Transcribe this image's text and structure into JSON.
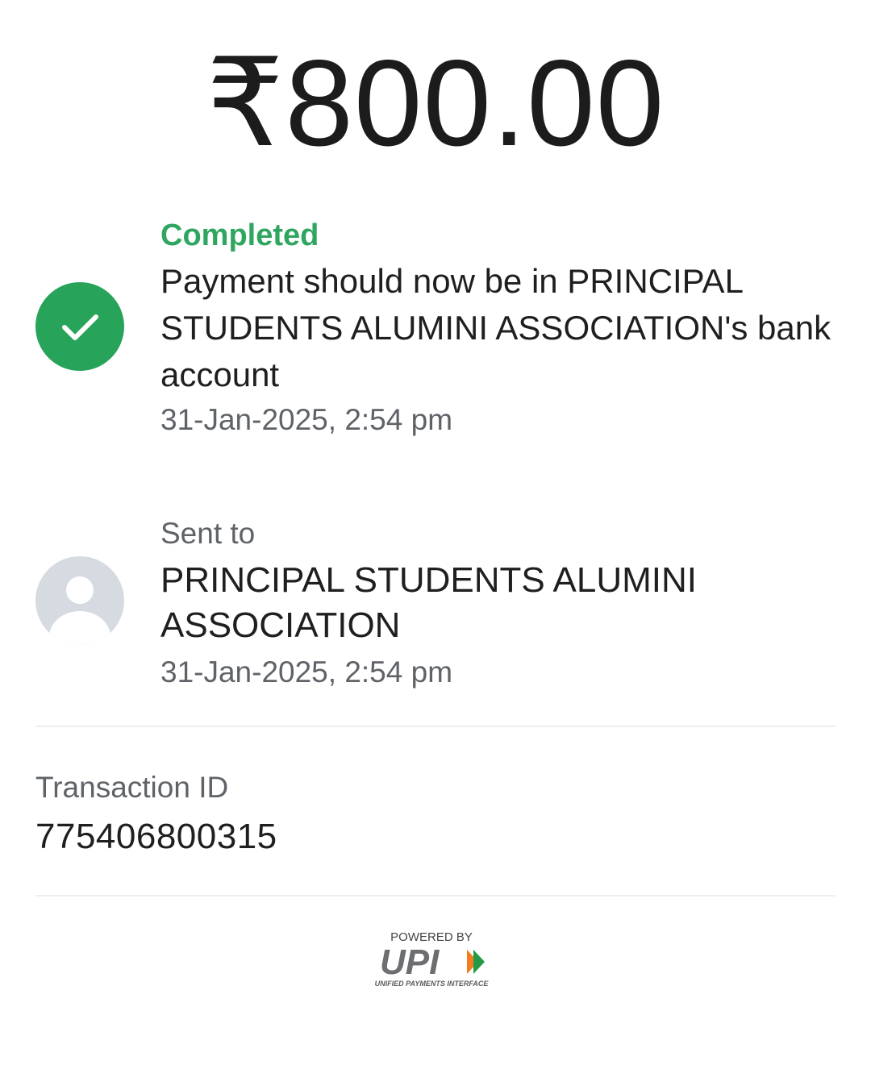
{
  "payment": {
    "amount": "₹800.00"
  },
  "status": {
    "label": "Completed",
    "message": "Payment should now be in PRINCIPAL STUDENTS ALUMINI ASSOCIATION's bank account",
    "timestamp": "31-Jan-2025, 2:54 pm",
    "icon": "check-circle-icon",
    "color": "#27a35a"
  },
  "recipient": {
    "label": "Sent to",
    "name": "PRINCIPAL STUDENTS ALUMINI ASSOCIATION",
    "timestamp": "31-Jan-2025, 2:54 pm",
    "icon": "avatar-placeholder-icon"
  },
  "transaction": {
    "label": "Transaction ID",
    "id": "775406800315"
  },
  "footer": {
    "powered_by": "POWERED BY",
    "logo_text": "UPI",
    "logo_subtitle": "UNIFIED PAYMENTS INTERFACE"
  }
}
